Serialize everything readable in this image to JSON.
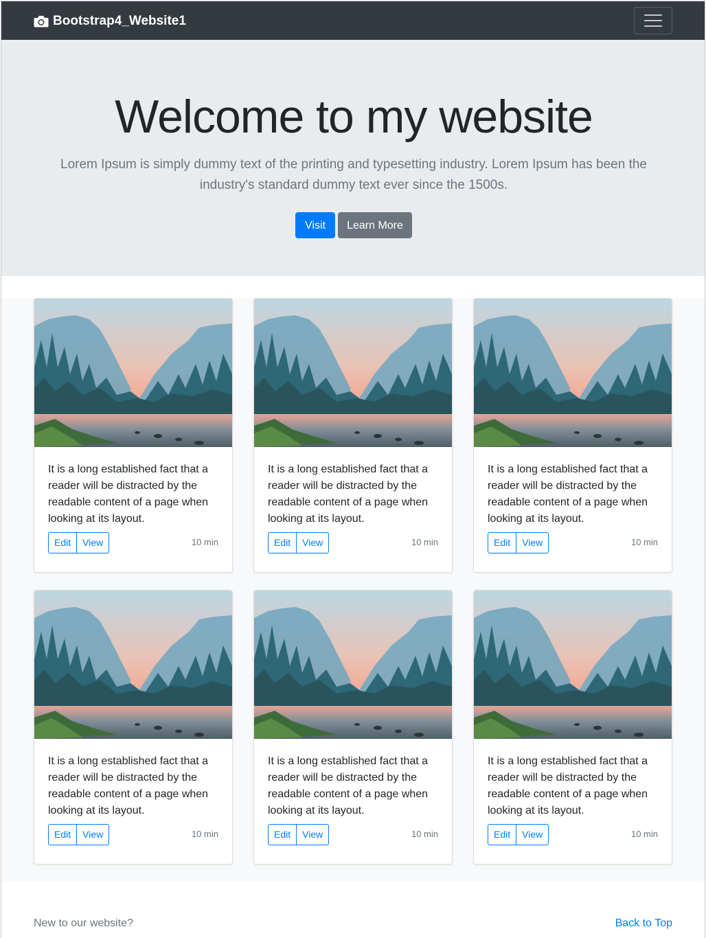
{
  "navbar": {
    "brand": "Bootstrap4_Website1",
    "brand_icon": "camera-icon",
    "toggler_icon": "hamburger-menu-icon"
  },
  "jumbotron": {
    "heading": "Welcome to my website",
    "lead": "Lorem Ipsum is simply dummy text of the printing and typesetting industry. Lorem Ipsum has been the industry's standard dummy text ever since the 1500s.",
    "primary_button": "Visit",
    "secondary_button": "Learn More"
  },
  "cards": [
    {
      "text": "It is a long established fact that a reader will be distracted by the readable content of a page when looking at its layout.",
      "edit_label": "Edit",
      "view_label": "View",
      "time": "10 min"
    },
    {
      "text": "It is a long established fact that a reader will be distracted by the readable content of a page when looking at its layout.",
      "edit_label": "Edit",
      "view_label": "View",
      "time": "10 min"
    },
    {
      "text": "It is a long established fact that a reader will be distracted by the readable content of a page when looking at its layout.",
      "edit_label": "Edit",
      "view_label": "View",
      "time": "10 min"
    },
    {
      "text": "It is a long established fact that a reader will be distracted by the readable content of a page when looking at its layout.",
      "edit_label": "Edit",
      "view_label": "View",
      "time": "10 min"
    },
    {
      "text": "It is a long established fact that a reader will be distracted by the readable content of a page when looking at its layout.",
      "edit_label": "Edit",
      "view_label": "View",
      "time": "10 min"
    },
    {
      "text": "It is a long established fact that a reader will be distracted by the readable content of a page when looking at its layout.",
      "edit_label": "Edit",
      "view_label": "View",
      "time": "10 min"
    }
  ],
  "footer": {
    "left_text": "New to our website?",
    "back_to_top": "Back to Top"
  },
  "colors": {
    "navbar_bg": "#343a40",
    "jumbotron_bg": "#e9ecef",
    "primary": "#007bff",
    "secondary": "#6c757d",
    "album_bg": "#f8f9fa"
  }
}
